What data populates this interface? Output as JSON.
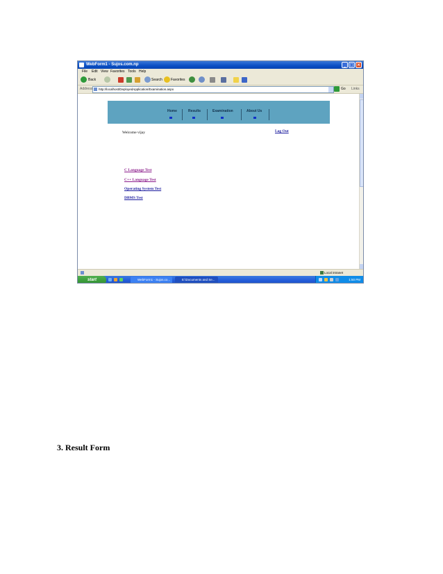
{
  "browser": {
    "window_title": "WebForm1 - Sujos.com.np",
    "menu": [
      "File",
      "Edit",
      "View",
      "Favorites",
      "Tools",
      "Help"
    ],
    "toolbar": {
      "back": "Back",
      "search": "Search",
      "favorites": "Favorites"
    },
    "address_label": "Address",
    "url": "http://localhost/DeployedApplication/Examination.aspx",
    "go": "Go",
    "links": "Links",
    "status": "Local intranet"
  },
  "page": {
    "nav": [
      "Home",
      "Results",
      "Examination",
      "About Us"
    ],
    "welcome": "Welcome vijay",
    "logout": "Log Out",
    "tests": [
      {
        "label": "C Language Test",
        "color": "#8b1c8b"
      },
      {
        "label": "C++ Language Test",
        "color": "#8b1c8b"
      },
      {
        "label": "Operating System Test",
        "color": "#1a1a9e"
      },
      {
        "label": "DBMS Test",
        "color": "#1a1a9e"
      }
    ]
  },
  "taskbar": {
    "start": "start",
    "tasks": [
      "WebForm1 - Sujos.co...",
      "E:\\Documents and Se..."
    ],
    "clock": "1:50 PM"
  },
  "caption": "3. Result Form"
}
